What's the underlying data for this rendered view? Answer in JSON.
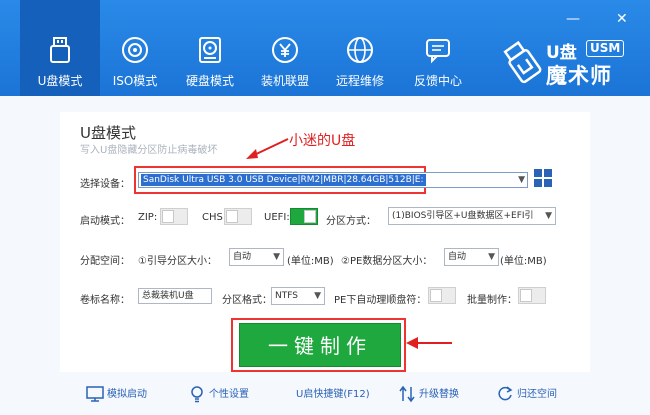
{
  "window": {
    "min": "—",
    "close": "✕"
  },
  "tabs": [
    {
      "label": "U盘模式",
      "icon": "usb-drive-icon",
      "active": true
    },
    {
      "label": "ISO模式",
      "icon": "disc-icon"
    },
    {
      "label": "硬盘模式",
      "icon": "hard-disk-icon"
    },
    {
      "label": "装机联盟",
      "icon": "yen-icon"
    },
    {
      "label": "远程维修",
      "icon": "globe-icon"
    },
    {
      "label": "反馈中心",
      "icon": "chat-icon"
    }
  ],
  "brand": {
    "line1": "U盘",
    "badge": "USM",
    "line2": "魔术师"
  },
  "main": {
    "title": "U盘模式",
    "subtitle": "写入U盘隐藏分区防止病毒破坏",
    "annotation": "小迷的U盘",
    "device_label": "选择设备：",
    "device_value": "SanDisk Ultra USB 3.0 USB Device|RM2|MBR|28.64GB|512B|E:",
    "boot_label": "启动模式：",
    "zip_label": "ZIP:",
    "chs_label": "CHS:",
    "uefi_label": "UEFI:",
    "partition_mode_label": "分区方式：",
    "partition_mode_value": "(1)BIOS引导区+U盘数据区+EFI引",
    "alloc_label": "分配空间：",
    "boot_size_label": "①引导分区大小：",
    "boot_size_value": "自动",
    "unit1": "(单位:MB)",
    "pe_size_label": "②PE数据分区大小：",
    "pe_size_value": "自动",
    "unit2": "(单位:MB)",
    "volume_label": "卷标名称：",
    "volume_value": "总裁装机U盘",
    "fs_label": "分区格式：",
    "fs_value": "NTFS",
    "hide_label": "PE下自动理顺盘符：",
    "batch_label": "批量制作：",
    "make_button": "一键制作"
  },
  "footer": [
    {
      "label": "模拟启动",
      "icon": "monitor-icon"
    },
    {
      "label": "个性设置",
      "icon": "bulb-icon"
    },
    {
      "label": "U启快捷键(F12)",
      "icon": ""
    },
    {
      "label": "升级替换",
      "icon": "swap-arrows-icon"
    },
    {
      "label": "归还空间",
      "icon": "refresh-icon"
    }
  ],
  "colors": {
    "header": "#1b74d6",
    "accent_green": "#1ea83e",
    "annotation_red": "#e02020",
    "link_blue": "#2a62b6"
  }
}
